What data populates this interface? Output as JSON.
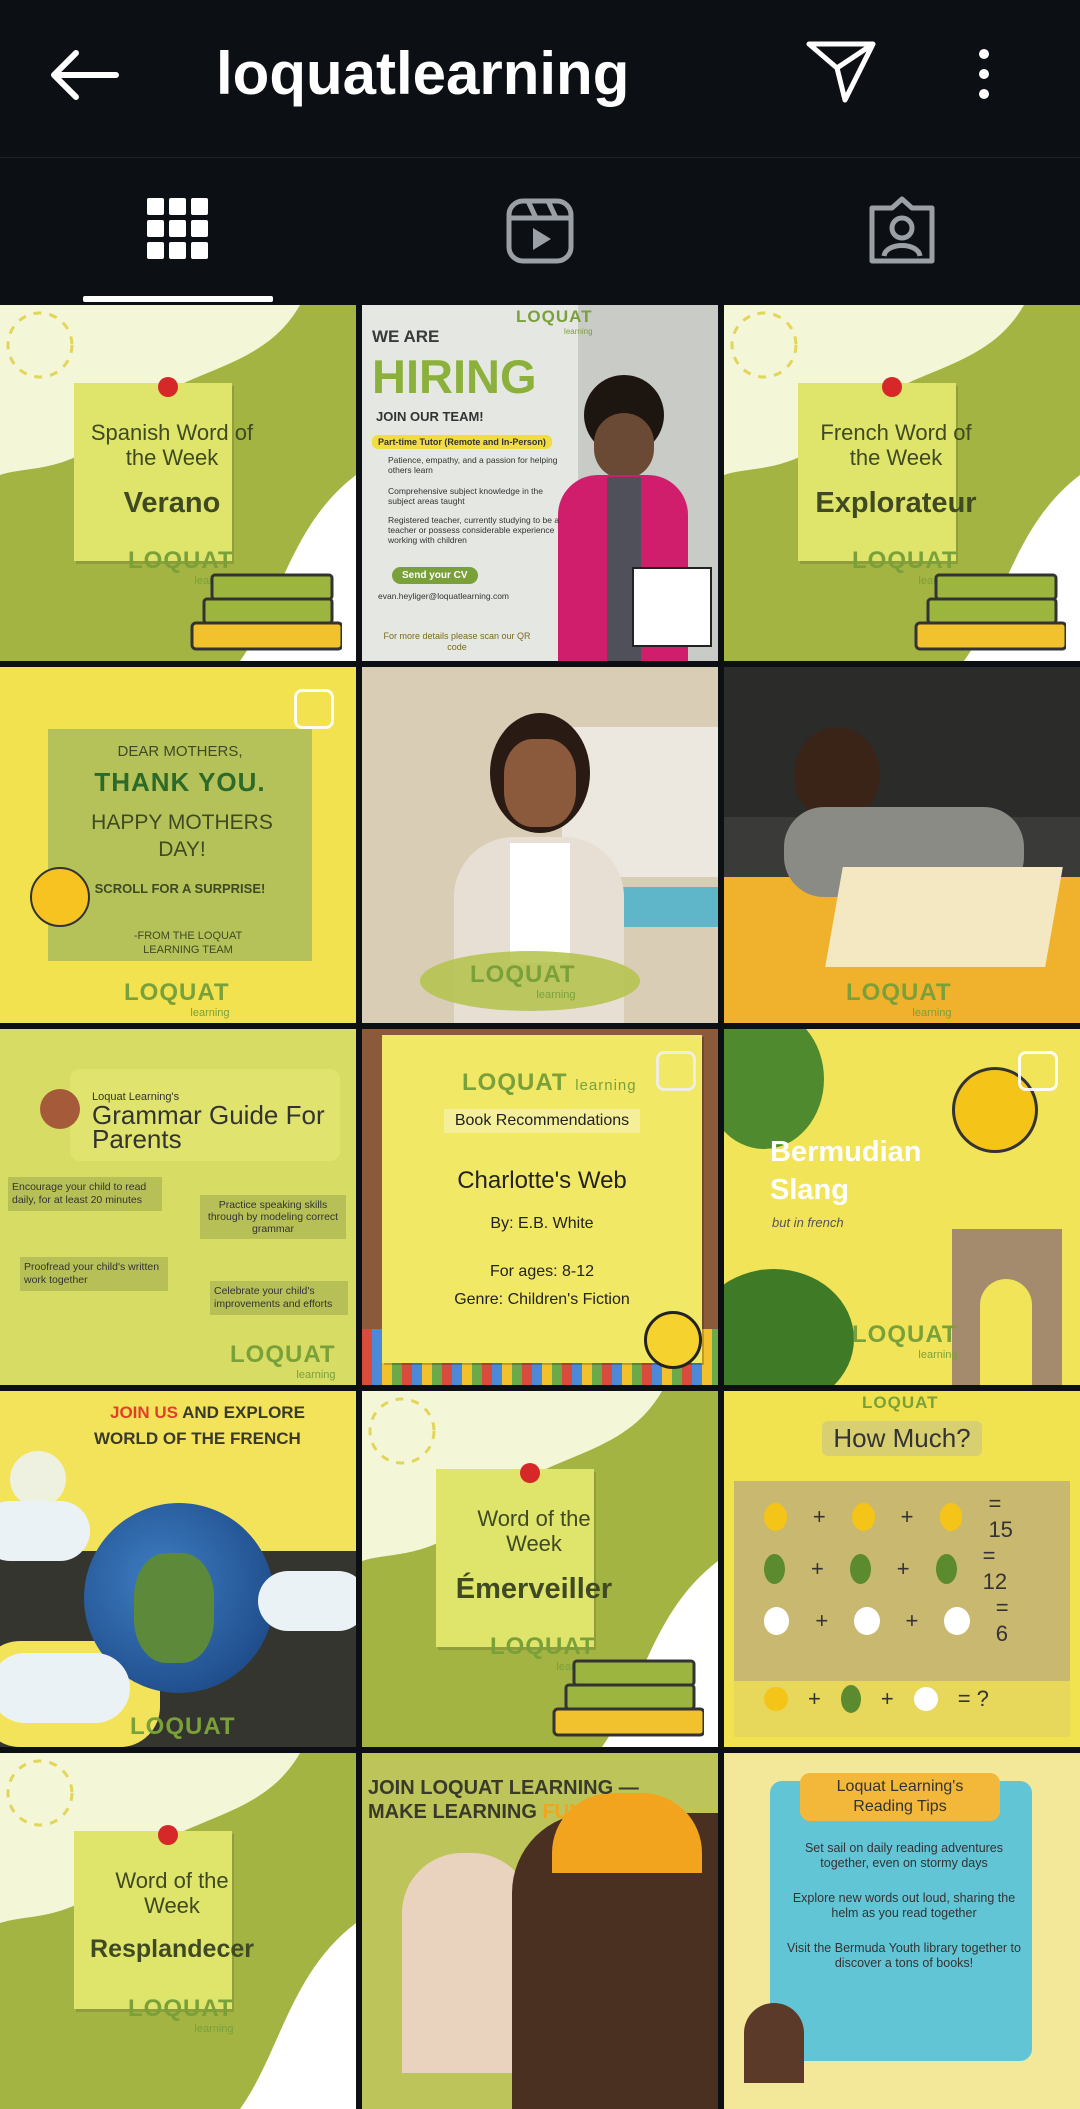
{
  "header": {
    "username": "loquatlearning"
  },
  "tabs": [
    {
      "name": "posts-grid"
    },
    {
      "name": "reels"
    },
    {
      "name": "tagged"
    }
  ],
  "posts": [
    {
      "kind": "word",
      "line1": "Spanish Word of",
      "line2": "the Week",
      "word": "Verano",
      "logo": "LOQUAT",
      "logo_sub": "learning"
    },
    {
      "kind": "hiring",
      "we_are": "WE ARE",
      "hiring": "HIRING",
      "join": "JOIN OUR TEAM!",
      "role": "Part-time Tutor (Remote and In-Person)",
      "reqs": [
        "Patience, empathy, and a passion for helping others learn",
        "Comprehensive subject knowledge in the subject areas taught",
        "Registered teacher, currently studying to be a teacher or possess considerable experience working with children"
      ],
      "cv": "Send your CV",
      "email": "evan.heyliger@loquatlearning.com",
      "details": "For more details please scan our QR code",
      "logo": "LOQUAT",
      "logo_sub": "learning"
    },
    {
      "kind": "word",
      "line1": "French Word of",
      "line2": "the Week",
      "word": "Explorateur",
      "logo": "LOQUAT",
      "logo_sub": "learning"
    },
    {
      "kind": "mothers",
      "dear": "DEAR MOTHERS,",
      "thanks": "THANK YOU.",
      "happy": "HAPPY MOTHERS DAY!",
      "scroll": "SCROLL FOR A SURPRISE!",
      "from": "-FROM THE LOQUAT LEARNING TEAM",
      "logo": "LOQUAT",
      "logo_sub": "learning"
    },
    {
      "kind": "photo-woman",
      "logo": "LOQUAT",
      "logo_sub": "learning"
    },
    {
      "kind": "photo-boy",
      "logo": "LOQUAT",
      "logo_sub": "learning"
    },
    {
      "kind": "grammar",
      "pre": "Loquat Learning's",
      "title": "Grammar Guide For Parents",
      "tips": [
        "Encourage your child to read daily, for at least 20 minutes",
        "Practice speaking skills through by modeling correct grammar",
        "Proofread your child's written work together",
        "Celebrate your child's improvements and efforts"
      ],
      "logo": "LOQUAT",
      "logo_sub": "learning"
    },
    {
      "kind": "book",
      "logo": "LOQUAT",
      "logo_sub": "learning",
      "heading": "Book Recommendations",
      "title": "Charlotte's Web",
      "by": "By: E.B. White",
      "ages": "For ages: 8-12",
      "genre": "Genre: Children's Fiction"
    },
    {
      "kind": "slang",
      "title": "Bermudian Slang",
      "sub": "but in french",
      "logo": "LOQUAT",
      "logo_sub": "learning"
    },
    {
      "kind": "earth",
      "join": "JOIN US",
      "rest1": " AND EXPLORE",
      "line2": "WORLD OF THE FRENCH",
      "logo": "LOQUAT"
    },
    {
      "kind": "word",
      "line1": "Word of the",
      "line2": "Week",
      "word": "Émerveiller",
      "logo": "LOQUAT",
      "logo_sub": "learning"
    },
    {
      "kind": "howmuch",
      "logo": "LOQUAT",
      "title": "How Much?",
      "eqs": [
        "= 15",
        "= 12",
        "= 6",
        "= ?"
      ]
    },
    {
      "kind": "word",
      "line1": "Word of the",
      "line2": "Week",
      "word": "Resplandecer",
      "logo": "LOQUAT",
      "logo_sub": "learning"
    },
    {
      "kind": "join",
      "line1": "JOIN LOQUAT LEARNING —",
      "line2a": "MAKE LEARNING ",
      "line2b": "FUN."
    },
    {
      "kind": "tips",
      "title1": "Loquat Learning's",
      "title2": "Reading Tips",
      "tips": [
        "Set sail on daily reading adventures together, even on stormy days",
        "Explore new words out loud, sharing the helm as you read together",
        "Visit the Bermuda Youth library together to discover a tons of books!"
      ]
    }
  ],
  "colors": {
    "bg": "#0c0f14",
    "olive": "#a3b443",
    "note": "#dfe46a",
    "yellow": "#f4e04d",
    "logo": "#7aa03a"
  },
  "icons": {
    "back": "arrow-left-icon",
    "send": "paper-plane-icon",
    "more": "more-vertical-icon",
    "grid": "grid-icon",
    "reels": "reels-icon",
    "tagged": "tagged-person-icon"
  }
}
